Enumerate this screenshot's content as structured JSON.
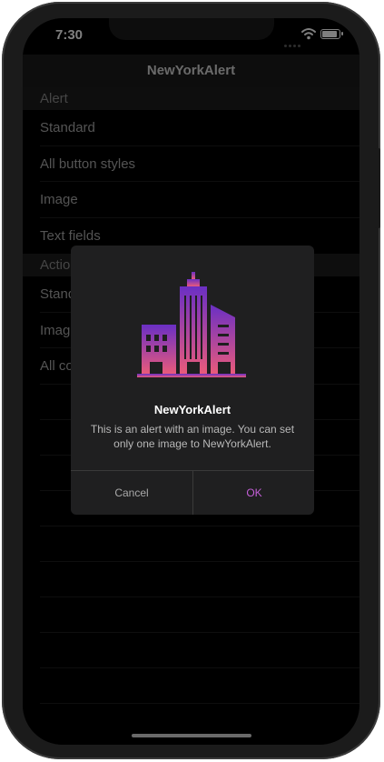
{
  "status_bar": {
    "time": "7:30"
  },
  "nav": {
    "title": "NewYorkAlert"
  },
  "sections": [
    {
      "header": "Alert",
      "rows": [
        "Standard",
        "All button styles",
        "Image",
        "Text fields"
      ]
    },
    {
      "header": "Action Sheet",
      "rows": [
        "Standard",
        "Image",
        "All components"
      ]
    }
  ],
  "alert": {
    "title": "NewYorkAlert",
    "message": "This is an alert with an image. You can set only one image to NewYorkAlert.",
    "image_icon": "city-buildings-icon",
    "cancel_label": "Cancel",
    "ok_label": "OK"
  },
  "colors": {
    "background": "#000000",
    "nav_bar": "#1b1b1b",
    "alert_bg": "#1f1f20",
    "ok_accent": "#c45fd8",
    "image_gradient_top": "#6a2fc4",
    "image_gradient_bottom": "#e95a7b"
  }
}
